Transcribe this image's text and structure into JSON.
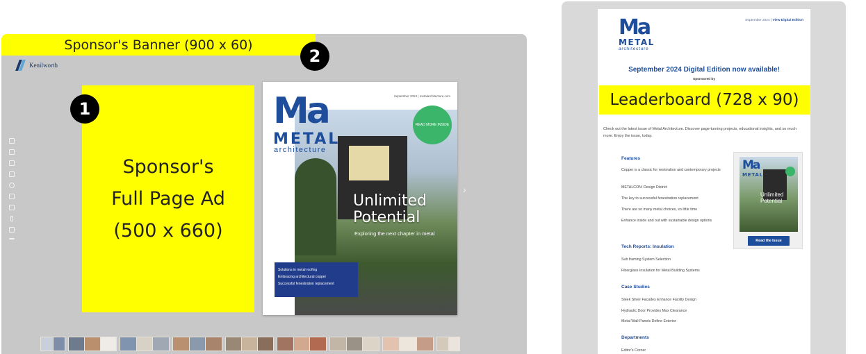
{
  "viewer": {
    "banner_label": "Sponsor's Banner (900 x 60)",
    "badge_1": "1",
    "badge_2": "2",
    "brand_name": "Kenilworth",
    "full_page_ad": [
      "Sponsor's",
      "Full Page Ad",
      "(500 x 660)"
    ],
    "next_arrow": "›",
    "cover": {
      "logo": "Ma",
      "metal": "METAL",
      "architecture": "architecture",
      "date_line": "September 2024  |  metalarchitecture.com",
      "seal_text": "READ MORE INSIDE",
      "headline_1": "Unlimited",
      "headline_2": "Potential",
      "tagline": "Exploring the next chapter in metal",
      "box_items": [
        "Solutions in metal roofing",
        "Embracing architectural copper",
        "Successful fenestration replacement"
      ]
    },
    "toolrail_icons": [
      "page-icon",
      "list-icon",
      "print-icon",
      "cloud-icon",
      "search-icon",
      "grid-icon",
      "fullscreen-icon",
      "bookmark-icon",
      "share-icon",
      "more-icon"
    ],
    "thumbnail_count": 9
  },
  "email": {
    "logo": "Ma",
    "logo_metal": "METAL",
    "logo_arch": "architecture",
    "top_date": "September 2024  |",
    "top_link": "View Digital Edition",
    "headline": "September 2024 Digital Edition now available!",
    "sponsored_by": "Sponsored by",
    "leaderboard_label": "Leaderboard (728 x 90)",
    "intro": "Check out the latest issue of Metal Architecture. Discover page-turning projects, educational insights, and so much more. Enjoy the issue, today.",
    "features_title": "Features",
    "features": [
      "Copper is a classic for restoration and contemporary projects",
      "METALCON: Design District",
      "The key to successful fenestration replacement",
      "There are so many metal choices, so little time",
      "Enhance inside and out with sustainable design options"
    ],
    "tech_title": "Tech Reports: Insulation",
    "tech": [
      "Sub framing System Selection",
      "Fiberglass Insulation for Metal Building Systems"
    ],
    "case_title": "Case Studies",
    "case": [
      "Sleek Silver Facades Enhance Facility Design",
      "Hydraulic Door Provides Max Clearance",
      "Metal Wall Panels Define Exterior"
    ],
    "dept_title": "Departments",
    "dept": [
      "Editor's Corner"
    ],
    "mini_cover": {
      "logo": "Ma",
      "metal": "METAL",
      "headline": "Unlimited Potential"
    },
    "read_button": "Read the Issue"
  },
  "colors": {
    "ad_yellow": "#ffff00",
    "brand_blue": "#1e4d9b",
    "viewer_gray": "#c8c8c8",
    "email_gray": "#d9d9d9",
    "seal_green": "#3bb56a"
  }
}
